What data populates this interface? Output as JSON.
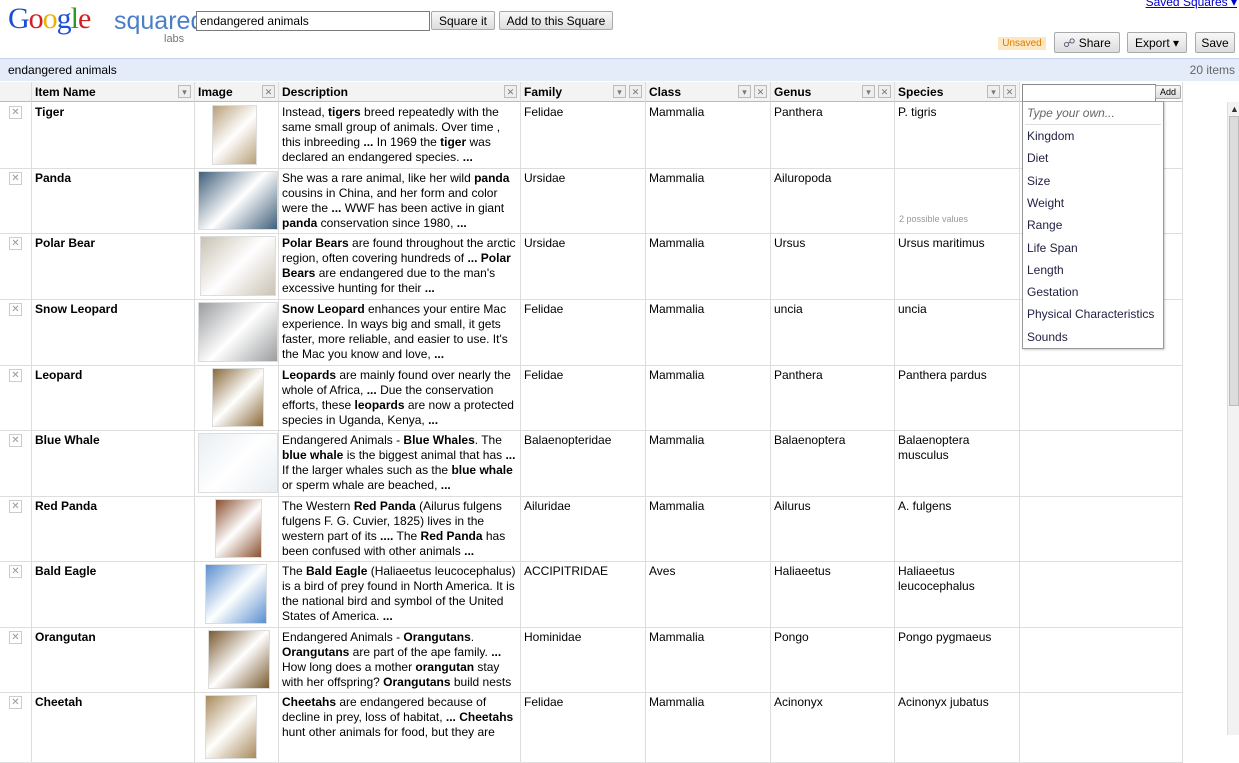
{
  "header": {
    "logo_text": "Google squared",
    "logo_labs": "labs",
    "search_value": "endangered animals",
    "square_it": "Square it",
    "add_to_square": "Add to this Square",
    "saved_squares": "Saved Squares ▾",
    "unsaved": "Unsaved",
    "share": "Share",
    "export": "Export ▾",
    "save": "Save"
  },
  "titlebar": {
    "query": "endangered animals",
    "count": "20 items"
  },
  "columns": [
    "Item Name",
    "Image",
    "Description",
    "Family",
    "Class",
    "Genus",
    "Species"
  ],
  "rows": [
    {
      "name": "Tiger",
      "desc_html": "Instead, <b>tigers</b> breed repeatedly with the same small group of animals. Over time , this inbreeding <b>...</b> In 1969 the <b>tiger</b> was declared an endangered species. <b>...</b>",
      "family": "Felidae",
      "class": "Mammalia",
      "genus": "Panthera",
      "species": "P. tigris",
      "img_color": "#b8a07a"
    },
    {
      "name": "Panda",
      "desc_html": "She was a rare animal, like her wild <b>panda</b> cousins in China, and her form and color were the <b>...</b> WWF has been active in giant <b>panda</b> conservation since 1980, <b>...</b>",
      "family": "Ursidae",
      "class": "Mammalia",
      "genus": "Ailuropoda",
      "species": "",
      "species_note": "2 possible values",
      "img_color": "#3f5f7a"
    },
    {
      "name": "Polar Bear",
      "desc_html": "<b>Polar Bears</b> are found throughout the arctic region, often covering hundreds of <b>... Polar Bears</b> are endangered due to the man's excessive hunting for their <b>...</b>",
      "family": "Ursidae",
      "class": "Mammalia",
      "genus": "Ursus",
      "species": "Ursus maritimus",
      "img_color": "#c9c2b4"
    },
    {
      "name": "Snow Leopard",
      "desc_html": "<b>Snow Leopard</b> enhances your entire Mac experience. In ways big and small, it gets faster, more reliable, and easier to use. It's the Mac you know and love, <b>...</b>",
      "family": "Felidae",
      "class": "Mammalia",
      "genus": "uncia",
      "species": "uncia",
      "img_color": "#9a9c9e"
    },
    {
      "name": "Leopard",
      "desc_html": "<b>Leopards</b> are mainly found over nearly the whole of Africa, <b>...</b> Due the conservation efforts, these <b>leopards</b> are now a protected species in Uganda, Kenya, <b>...</b>",
      "family": "Felidae",
      "class": "Mammalia",
      "genus": "Panthera",
      "species": "Panthera pardus",
      "img_color": "#8a6a3a"
    },
    {
      "name": "Blue Whale",
      "desc_html": "Endangered Animals - <b>Blue Whales</b>. The <b>blue whale</b> is the biggest animal that has <b>...</b> If the larger whales such as the <b>blue whale</b> or sperm whale are beached, <b>...</b>",
      "family": "Balaenopteridae",
      "class": "Mammalia",
      "genus": "Balaenoptera",
      "species": "Balaenoptera musculus",
      "img_color": "#e8eef2"
    },
    {
      "name": "Red Panda",
      "desc_html": "The Western <b>Red Panda</b> (Ailurus fulgens fulgens F. G. Cuvier, 1825) lives in the western part of its <b>....</b> The <b>Red Panda</b> has been confused with other animals <b>...</b>",
      "family": "Ailuridae",
      "class": "Mammalia",
      "genus": "Ailurus",
      "species": "A. fulgens",
      "img_color": "#8a5030"
    },
    {
      "name": "Bald Eagle",
      "desc_html": "The <b>Bald Eagle</b> (Haliaeetus leucocephalus) is a bird of prey found in North America. It is the national bird and symbol of the United States of America. <b>...</b>",
      "family": "ACCIPITRIDAE",
      "class": "Aves",
      "genus": "Haliaeetus",
      "species": "Haliaeetus leucocephalus",
      "img_color": "#5a8fd0"
    },
    {
      "name": "Orangutan",
      "desc_html": "Endangered Animals - <b>Orangutans</b>. <b>Orangutans</b> are part of the ape family. <b>...</b> How long does a mother <b>orangutan</b> stay with her offspring? <b>Orangutans</b> build nests",
      "family": "Hominidae",
      "class": "Mammalia",
      "genus": "Pongo",
      "species": "Pongo pygmaeus",
      "img_color": "#7a5a30"
    },
    {
      "name": "Cheetah",
      "desc_html": "<b>Cheetahs</b> are endangered because of decline in prey, loss of habitat, <b>... Cheetahs</b> hunt other animals for food, but they are",
      "family": "Felidae",
      "class": "Mammalia",
      "genus": "Acinonyx",
      "species": "Acinonyx jubatus",
      "img_color": "#a88a5a"
    }
  ],
  "add_column": {
    "button": "Add",
    "placeholder": "Type your own...",
    "options": [
      "Kingdom",
      "Diet",
      "Size",
      "Weight",
      "Range",
      "Life Span",
      "Length",
      "Gestation",
      "Physical Characteristics",
      "Sounds"
    ]
  }
}
